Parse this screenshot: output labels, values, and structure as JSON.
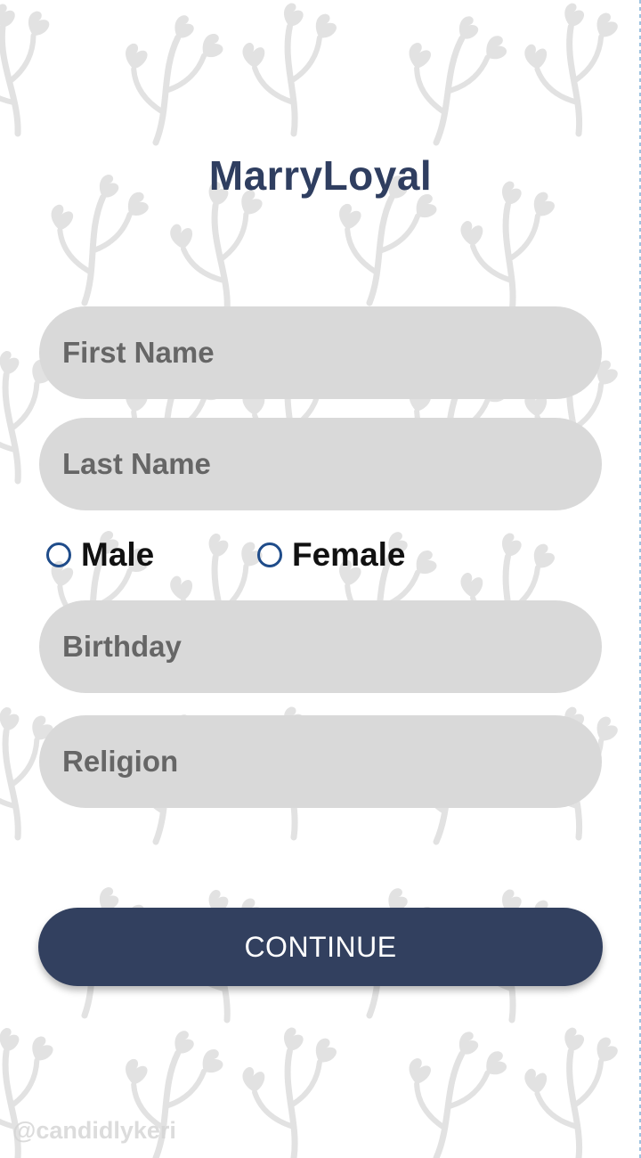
{
  "app": {
    "title": "MarryLoyal"
  },
  "form": {
    "first_name": {
      "placeholder": "First Name",
      "value": ""
    },
    "last_name": {
      "placeholder": "Last Name",
      "value": ""
    },
    "gender": {
      "options": [
        {
          "label": "Male",
          "selected": false
        },
        {
          "label": "Female",
          "selected": false
        }
      ]
    },
    "birthday": {
      "placeholder": "Birthday",
      "value": ""
    },
    "religion": {
      "placeholder": "Religion",
      "value": ""
    },
    "continue_label": "CONTINUE"
  },
  "background": {
    "watermark": "@candidlykeri",
    "pattern": "leaf-vine"
  },
  "colors": {
    "brand": "#2f3e60",
    "button": "#32405f",
    "field_bg": "#d9d9d9",
    "radio_ring": "#1f4c8a",
    "pattern": "#e4e4e4"
  },
  "icons": {
    "radio": "radio-unchecked-icon"
  }
}
